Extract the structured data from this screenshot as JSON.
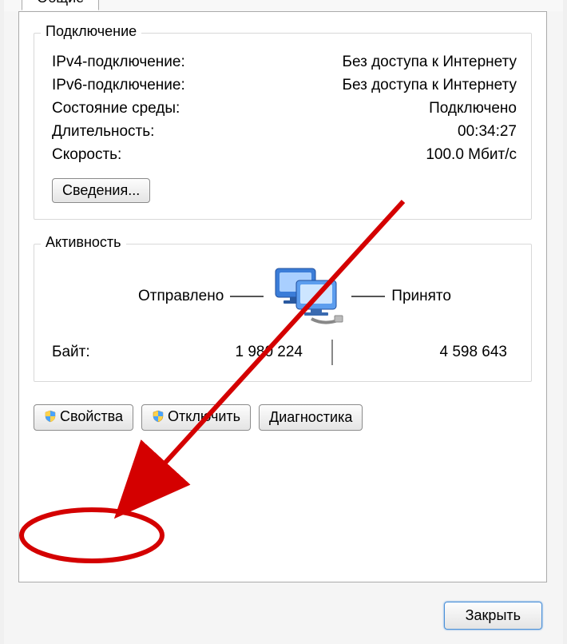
{
  "tabs": {
    "active_label": "Общие"
  },
  "connection": {
    "group_label": "Подключение",
    "rows": [
      {
        "label": "IPv4-подключение:",
        "value": "Без доступа к Интернету"
      },
      {
        "label": "IPv6-подключение:",
        "value": "Без доступа к Интернету"
      },
      {
        "label": "Состояние среды:",
        "value": "Подключено"
      },
      {
        "label": "Длительность:",
        "value": "00:34:27"
      },
      {
        "label": "Скорость:",
        "value": "100.0 Мбит/с"
      }
    ],
    "details_button": "Сведения..."
  },
  "activity": {
    "group_label": "Активность",
    "sent_label": "Отправлено",
    "recv_label": "Принято",
    "bytes_label": "Байт:",
    "bytes_sent": "1 980 224",
    "bytes_recv": "4 598 643",
    "icon": "network-computers-icon"
  },
  "buttons": {
    "properties": "Свойства",
    "disable": "Отключить",
    "diagnose": "Диагностика",
    "close": "Закрыть"
  },
  "annotation": {
    "target": "properties-button",
    "shape": "red-circle-with-arrow"
  }
}
